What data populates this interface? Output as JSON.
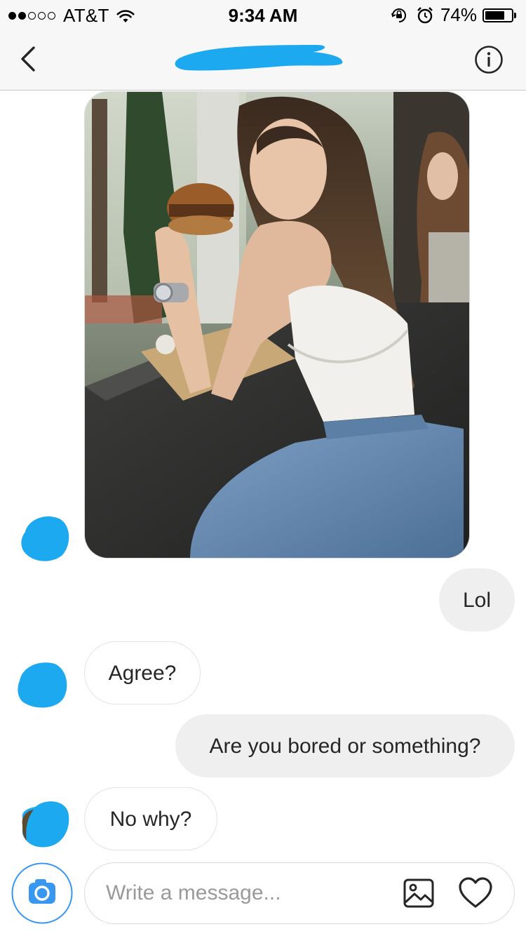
{
  "status_bar": {
    "carrier": "AT&T",
    "signal_bars_filled": 2,
    "signal_bars_total": 5,
    "time": "9:34 AM",
    "battery_percent_text": "74%",
    "battery_level": 0.74,
    "icons": [
      "wifi-icon",
      "orientation-lock-icon",
      "alarm-icon",
      "battery-icon"
    ]
  },
  "header": {
    "back_icon": "chevron-left-icon",
    "info_icon": "info-icon",
    "title_redaction_color": "#1da9f0"
  },
  "messages": [
    {
      "type": "photo",
      "sender": "them",
      "description_icon": "photo-message"
    },
    {
      "type": "text",
      "sender": "me",
      "text": "Lol"
    },
    {
      "type": "text",
      "sender": "them",
      "text": "Agree?"
    },
    {
      "type": "text",
      "sender": "me",
      "text": "Are you bored or something?"
    },
    {
      "type": "text",
      "sender": "them",
      "text": "No why?"
    }
  ],
  "composer": {
    "placeholder": "Write a message...",
    "value": "",
    "camera_icon": "camera-icon",
    "gallery_icon": "image-gallery-icon",
    "heart_icon": "heart-icon"
  },
  "colors": {
    "redaction": "#1da9f0",
    "camera_button": "#3897f0",
    "outgoing_bubble": "#efefef",
    "incoming_border": "#e3e3e3"
  }
}
